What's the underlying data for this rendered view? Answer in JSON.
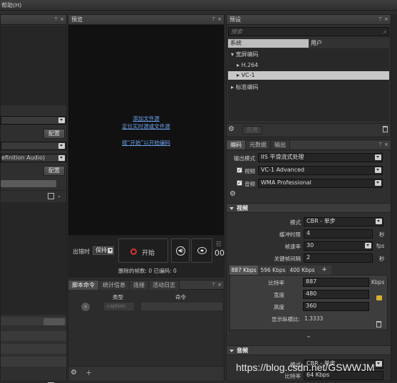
{
  "menubar": {
    "help": "帮助(H)"
  },
  "left": {
    "config_btn_1": "配置",
    "audio_partial": "efinition Audio)",
    "config_btn_2": "配置"
  },
  "preview": {
    "title": "预览",
    "link_add_file": "添加文件源",
    "link_locate_live": "定位实时源或文件源",
    "link_start": "按“开始”以开始编码",
    "on_error_label": "出错时",
    "on_error_value": "保持",
    "start_label": "开始",
    "dropped_frames": "删除的帧数: 0 已编码: 0",
    "side_partial_1": "已",
    "side_partial_2": "00"
  },
  "bottom_tabs": {
    "tabs": [
      "脚本命令",
      "统计信息",
      "连接",
      "活动日志"
    ],
    "col_type": "类型",
    "col_command": "命令",
    "caption_value": "caption"
  },
  "presets": {
    "title": "预设",
    "search_placeholder": "搜索",
    "tabs": [
      "系统",
      "用户"
    ],
    "tree": [
      {
        "label": "宽屏编码",
        "expanded": true
      },
      {
        "label": "H.264",
        "expanded": false
      },
      {
        "label": "VC-1",
        "expanded": false,
        "selected": true
      },
      {
        "label": "标准编码",
        "expanded": false
      }
    ],
    "apply_btn": "应用"
  },
  "encoding": {
    "tabs": [
      "编码",
      "元数据",
      "输出"
    ],
    "output_mode_label": "输出模式",
    "output_mode_value": "IIS 平滑流式处理",
    "video_label": "视频",
    "video_codec": "VC-1 Advanced",
    "audio_label": "音频",
    "audio_codec": "WMA Professional",
    "video_section": "视频",
    "mode_label": "模式",
    "mode_value": "CBR - 单步",
    "buffer_label": "缓冲时限",
    "buffer_value": "4",
    "buffer_unit": "秒",
    "framerate_label": "帧速率",
    "framerate_value": "30",
    "framerate_unit": "fps",
    "keyframe_label": "关键帧间隔",
    "keyframe_value": "2",
    "keyframe_unit": "秒",
    "bitrate_tabs": [
      "887 Kbps",
      "596 Kbps",
      "400 Kbps",
      "+"
    ],
    "bitrate_label": "比特率",
    "bitrate_value": "887",
    "bitrate_unit": "Kbps",
    "width_label": "宽度",
    "width_value": "480",
    "height_label": "高度",
    "height_value": "360",
    "aspect_label": "显示纵横比:",
    "aspect_value": "1.3333",
    "audio_section": "音频",
    "audio_mode_label": "模式",
    "audio_mode_value": "CBR - 单步",
    "audio_partial_label": "比特率",
    "audio_partial_value": "64 Kbps"
  },
  "watermark": "https://blog.csdn.net/GSWWJM"
}
